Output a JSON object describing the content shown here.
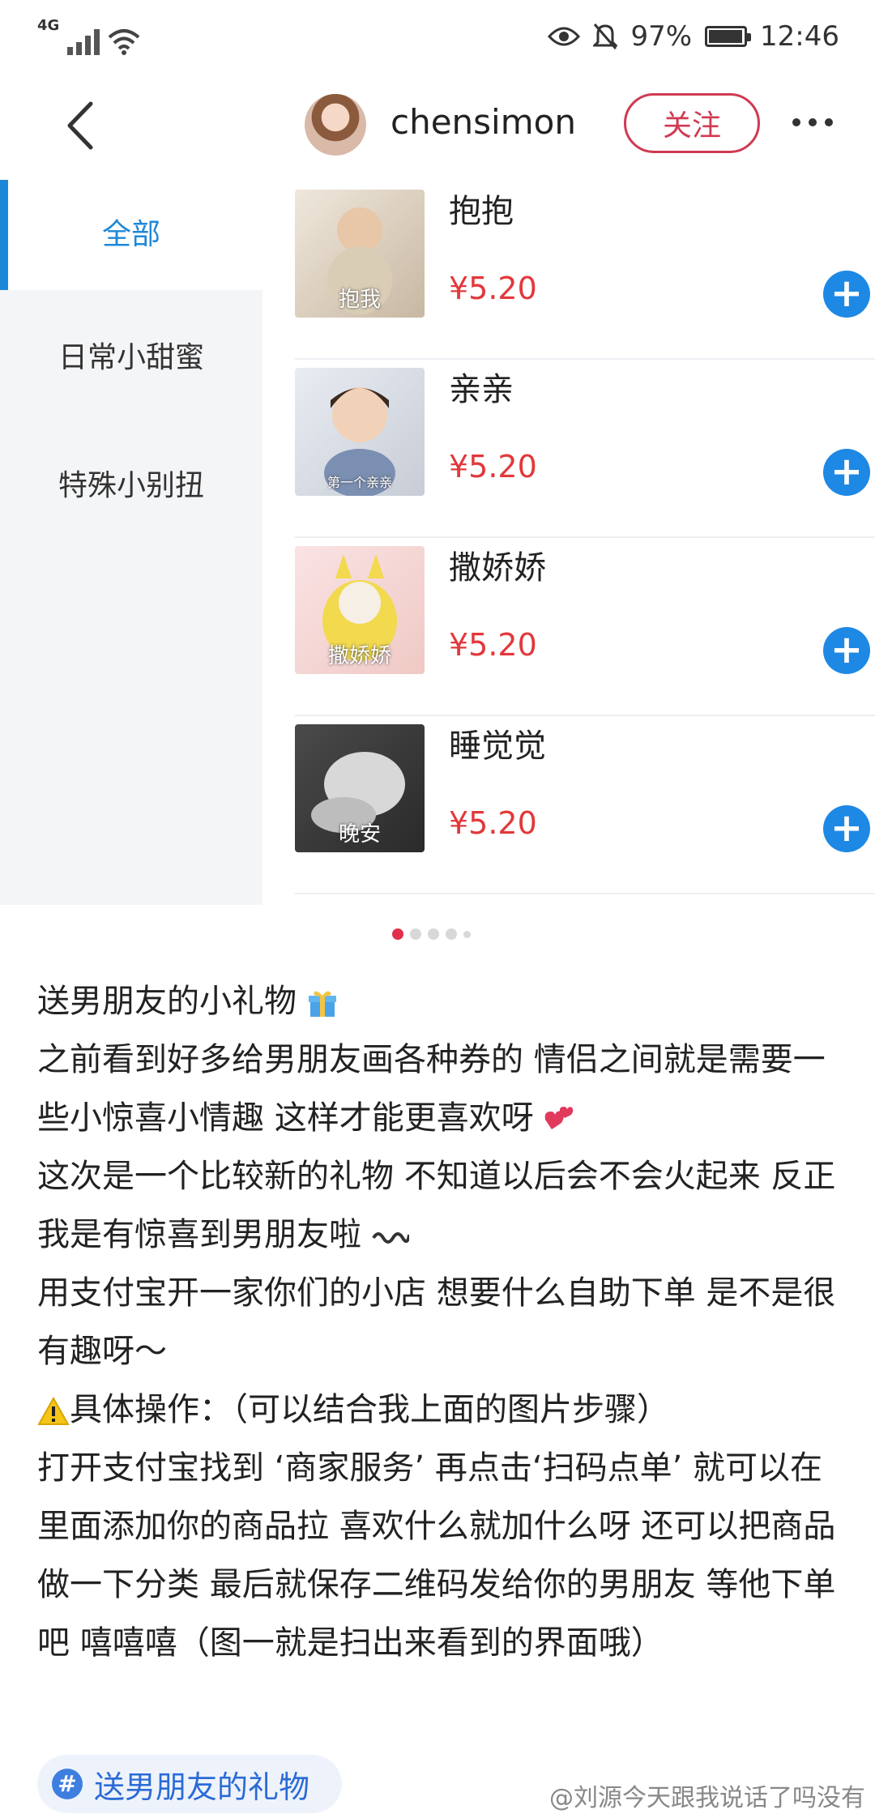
{
  "status_bar": {
    "network": "4G",
    "battery": "97%",
    "battery_level": 0.97,
    "time": "12:46",
    "icons": [
      "signal-icon",
      "wifi-icon",
      "eye-icon",
      "bell-off-icon",
      "battery-icon"
    ]
  },
  "header": {
    "username": "chensimon",
    "follow_label": "关注",
    "icons": [
      "back-arrow-icon",
      "more-icon"
    ]
  },
  "shop": {
    "categories": [
      "全部",
      "日常小甜蜜",
      "特殊小别扭"
    ],
    "products": [
      {
        "name": "抱抱",
        "price": "¥5.20",
        "image_caption": "抱我"
      },
      {
        "name": "亲亲",
        "price": "¥5.20",
        "image_caption": "第一个亲亲"
      },
      {
        "name": "撒娇娇",
        "price": "¥5.20",
        "image_caption": "撒娇娇"
      },
      {
        "name": "睡觉觉",
        "price": "¥5.20",
        "image_caption": "晚安"
      }
    ]
  },
  "pager": {
    "total": 5,
    "current": 1
  },
  "post": {
    "lines": [
      "送男朋友的小礼物",
      "之前看到好多给男朋友画各种券的 情侣之间就是需要一些小惊喜小情趣 这样才能更喜欢呀",
      "这次是一个比较新的礼物 不知道以后会不会火起来 反正我是有惊喜到男朋友啦",
      "用支付宝开一家你们的小店 想要什么自助下单 是不是很有趣呀～",
      "具体操作：（可以结合我上面的图片步骤）",
      "打开支付宝找到 ‘商家服务’ 再点击‘扫码点单’ 就可以在里面添加你的商品拉 喜欢什么就加什么呀 还可以把商品做一下分类 最后就保存二维码发给你的男朋友 等他下单吧 嘻嘻嘻（图一就是扫出来看到的界面哦）"
    ]
  },
  "tag": {
    "label": "送男朋友的礼物"
  },
  "watermark": "@刘源今天跟我说话了吗没有",
  "colors": {
    "accent_blue": "#1e88e5",
    "price_red": "#e2383b",
    "follow_red": "#d03a52"
  }
}
